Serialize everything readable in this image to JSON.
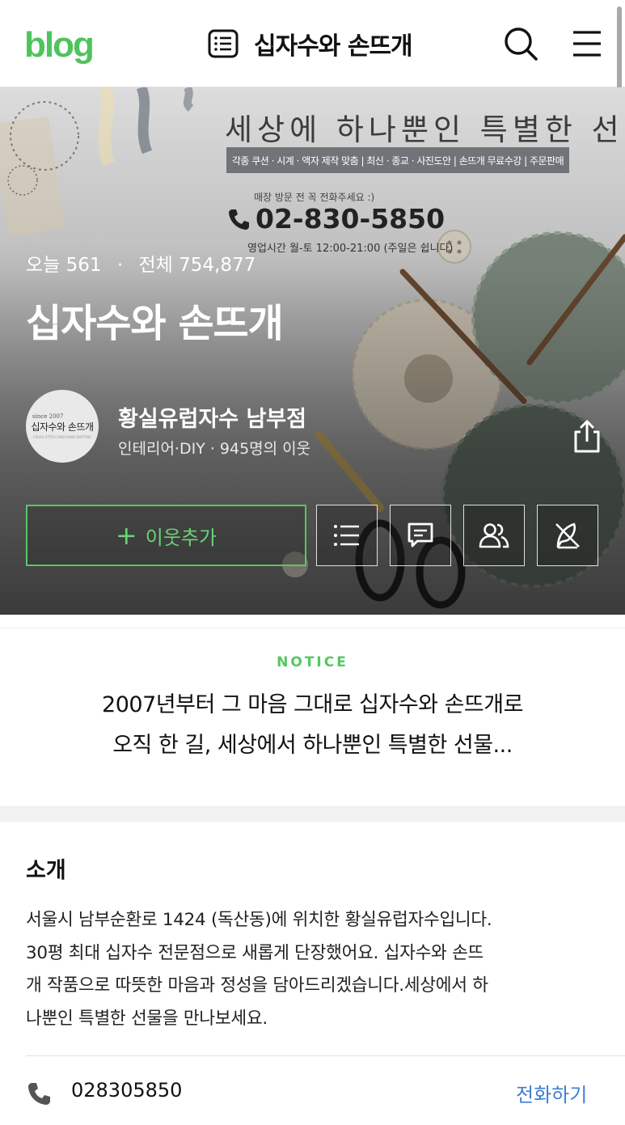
{
  "header": {
    "logo": "blog",
    "title": "십자수와 손뜨개",
    "icons": [
      "posts-list-icon",
      "search-icon",
      "menu-icon"
    ]
  },
  "banner": {
    "headline": "세상에 하나뿐인 특별한 선물",
    "services": "각종 쿠션 · 시계 · 액자 제작 맞춤 | 최신 · 종교 · 사진도안 | 손뜨개 무료수강 | 주문판매",
    "visit_note": "매장 방문 전 꼭 전화주세요 :)",
    "phone": "02-830-5850",
    "hours": "영업시간 월-토 12:00-21:00 (주일은 쉽니다)"
  },
  "profile": {
    "today_label": "오늘",
    "today_count": "561",
    "total_label": "전체",
    "total_count": "754,877",
    "blog_name": "십자수와 손뜨개",
    "owner_name": "황실유럽자수 남부점",
    "category_neighbors": "인테리어·DIY · 945명의 이웃",
    "avatar_since": "since 2007",
    "avatar_name": "십자수와 손뜨개",
    "avatar_sub": "CROSS STITCH AND HAND KNITTING",
    "add_neighbor_label": "이웃추가"
  },
  "notice": {
    "label": "NOTICE",
    "line1": "2007년부터 그 마음 그대로 십자수와 손뜨개로",
    "line2": "오직 한 길, 세상에서 하나뿐인 특별한 선물..."
  },
  "intro": {
    "title": "소개",
    "line1": "서울시 남부순환로 1424 (독산동)에 위치한 황실유럽자수입니다.",
    "line2": "30평 최대 십자수 전문점으로 새롭게 단장했어요. 십자수와 손뜨",
    "line3": "개 작품으로 따뜻한 마음과 정성을 담아드리겠습니다.세상에서 하",
    "line4": "나뿐인 특별한 선물을 만나보세요.",
    "phone": "028305850",
    "call_label": "전화하기"
  },
  "colors": {
    "brand_green": "#55c761",
    "link_blue": "#3f7fd1"
  }
}
